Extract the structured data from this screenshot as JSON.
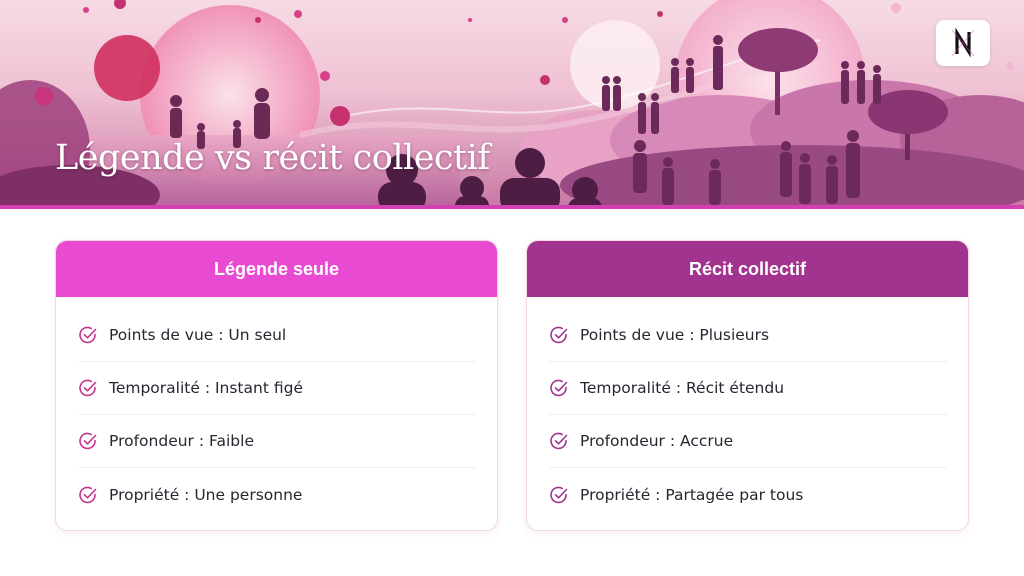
{
  "slide": {
    "title": "Légende vs récit collectif",
    "logo_icon": "n-logo-icon",
    "accent_bar_color": "#d43fb4"
  },
  "cards": [
    {
      "header": "Légende seule",
      "header_color": "#e84bd1",
      "items": [
        "Points de vue : Un seul",
        "Temporalité : Instant figé",
        "Profondeur : Faible",
        "Propriété : Une personne"
      ]
    },
    {
      "header": "Récit collectif",
      "header_color": "#a2348f",
      "items": [
        "Points de vue : Plusieurs",
        "Temporalité : Récit étendu",
        "Profondeur : Accrue",
        "Propriété : Partagée par tous"
      ]
    }
  ],
  "icons": {
    "check": "check-circle-icon"
  }
}
